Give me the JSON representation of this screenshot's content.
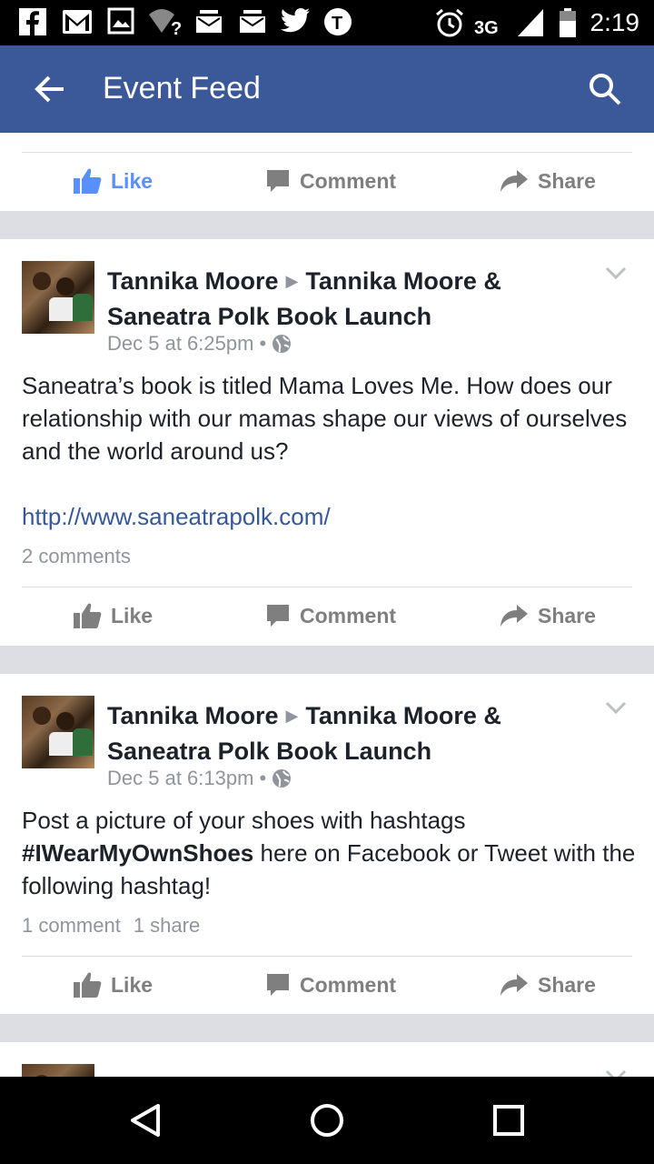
{
  "status_bar": {
    "time": "2:19",
    "network": "3G",
    "icons": [
      "facebook-icon",
      "gmail-icon",
      "gallery-icon",
      "wifi-unknown-icon",
      "mail-icon",
      "mail-icon",
      "twitter-icon",
      "tumblr-icon",
      "alarm-icon",
      "signal-icon",
      "battery-icon"
    ]
  },
  "app_bar": {
    "title": "Event Feed",
    "back_icon": "arrow-left-icon",
    "search_icon": "search-icon"
  },
  "actions": {
    "like": "Like",
    "comment": "Comment",
    "share": "Share"
  },
  "posts": [
    {
      "author": "Tannika Moore",
      "target": "Tannika Moore & Saneatra Polk Book Launch",
      "timestamp": "Dec 5 at 6:25pm",
      "text": "Saneatra’s book is titled Mama Loves Me. How does our relationship with our mamas shape our views of ourselves and the world around us?",
      "link": "http://www.saneatrapolk.com/",
      "comments": "2 comments"
    },
    {
      "author": "Tannika Moore",
      "target": "Tannika Moore & Saneatra Polk Book Launch",
      "timestamp": "Dec 5 at 6:13pm",
      "text_before": "Post a picture of your shoes with hashtags ",
      "hashtag": "#IWearMyOwnShoes",
      "text_after": " here on Facebook or Tweet with the following hashtag!",
      "comments": "1 comment",
      "shares": "1 share"
    }
  ],
  "colors": {
    "app_bar": "#3b5998",
    "liked": "#5890ff",
    "link": "#365899",
    "muted": "#90949c"
  }
}
